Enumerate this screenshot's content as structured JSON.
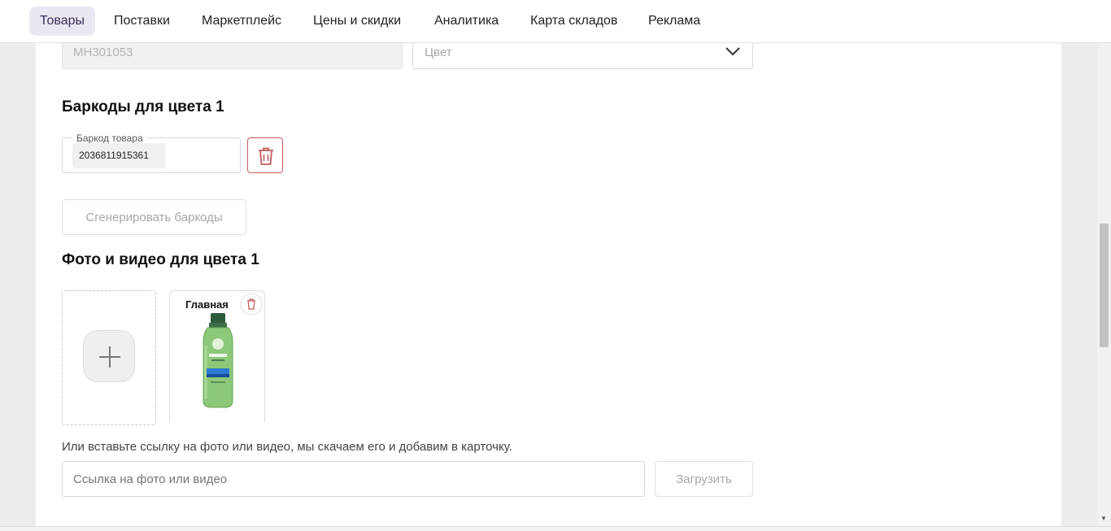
{
  "nav": {
    "items": [
      {
        "label": "Товары",
        "active": true
      },
      {
        "label": "Поставки"
      },
      {
        "label": "Маркетплейс"
      },
      {
        "label": "Цены и скидки"
      },
      {
        "label": "Аналитика"
      },
      {
        "label": "Карта складов"
      },
      {
        "label": "Реклама"
      }
    ]
  },
  "form": {
    "article_value": "MH301053",
    "color_placeholder": "Цвет",
    "barcodes_title": "Баркоды для цвета 1",
    "barcode_label": "Баркод товара",
    "barcode_value": "2036811915361",
    "generate_button": "Сгенерировать баркоды",
    "media_title": "Фото и видео для цвета 1",
    "photo_main_label": "Главная",
    "link_hint": "Или вставьте ссылку на фото или видео, мы скачаем его и добавим в карточку.",
    "link_placeholder": "Ссылка на фото или видео",
    "upload_button": "Загрузить"
  },
  "colors": {
    "accent_active_bg": "#ebe7f2",
    "danger": "#c65b5b",
    "bottle_green": "#8cc878"
  }
}
